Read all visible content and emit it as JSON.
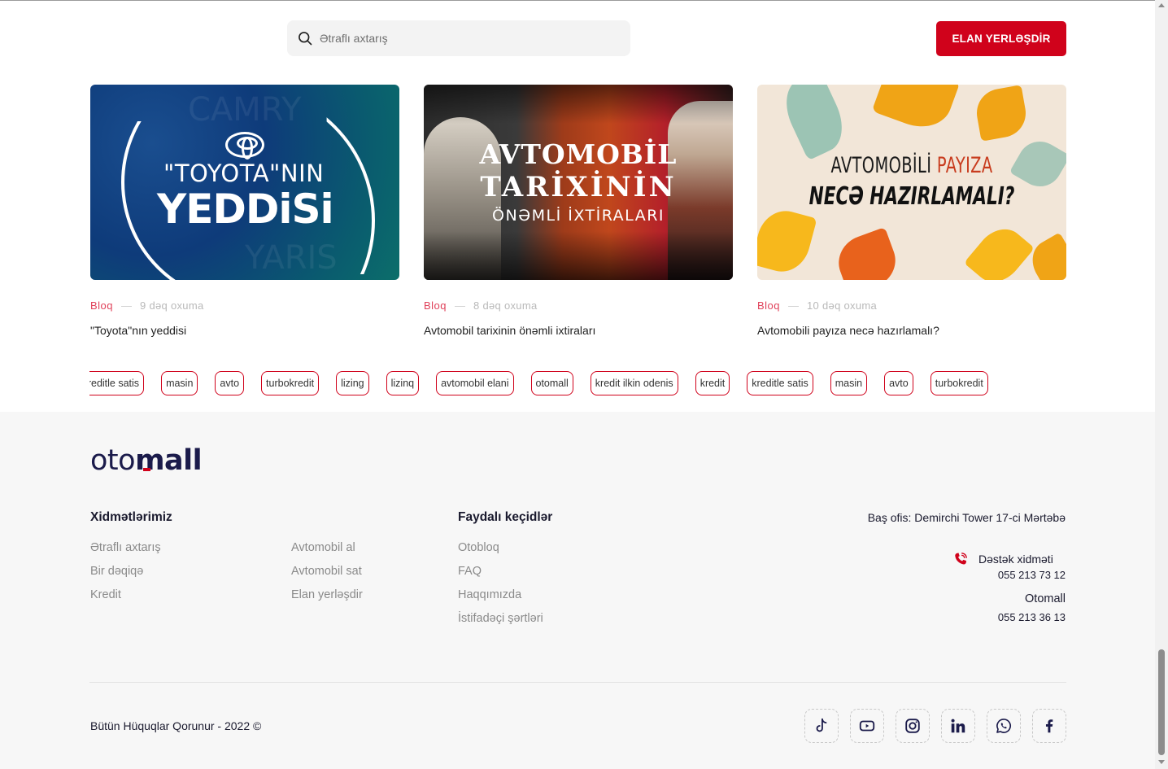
{
  "header": {
    "search_placeholder": "Ətraflı axtarış",
    "cta_label": "ELAN YERLƏŞDİR"
  },
  "cards": [
    {
      "category": "Bloq",
      "read_time": "9 dəq oxuma",
      "title": "\"Toyota\"nın yeddisi",
      "image_line1": "\"TOYOTA\"NIN",
      "image_line2": "YEDDiSi"
    },
    {
      "category": "Bloq",
      "read_time": "8 dəq oxuma",
      "title": "Avtomobil tarixinin önəmli ixtiraları",
      "image_line1": "AVTOMOBİL",
      "image_line2": "TARİXİNİN",
      "image_line3": "ÖNƏMLİ İXTİRALARI"
    },
    {
      "category": "Bloq",
      "read_time": "10 dəq oxuma",
      "title": "Avtomobili payıza necə hazırlamalı?",
      "image_line1a": "AVTOMOBİLİ ",
      "image_line1b": "PAYIZA",
      "image_line2": "NECƏ HAZIRLAMALI?"
    }
  ],
  "tags": [
    "kredit",
    "kreditle satis",
    "masin",
    "avto",
    "turbokredit",
    "lizing",
    "lizinq",
    "avtomobil elani",
    "otomall",
    "kredit ilkin odenis",
    "kredit",
    "kreditle satis",
    "masin",
    "avto",
    "turbokredit"
  ],
  "footer": {
    "brand_light": "oto",
    "brand_bold": "mall",
    "services_heading": "Xidmətlərimiz",
    "services_col1": [
      "Ətraflı axtarış",
      "Bir dəqiqə",
      "Kredit"
    ],
    "services_col2": [
      "Avtomobil al",
      "Avtomobil sat",
      "Elan yerləşdir"
    ],
    "links_heading": "Faydalı keçidlər",
    "links": [
      "Otobloq",
      "FAQ",
      "Haqqımızda",
      "İstifadəçi şərtləri"
    ],
    "office": "Baş ofis: Demirchi Tower 17-ci Mərtəbə",
    "support_label": "Dəstək xidməti",
    "support_phone": "055 213 73 12",
    "otomall_label": "Otomall",
    "otomall_phone": "055 213 36 13",
    "copyright": "Bütün Hüquqlar Qorunur - 2022 ©",
    "social": [
      "tiktok-icon",
      "youtube-icon",
      "instagram-icon",
      "linkedin-icon",
      "whatsapp-icon",
      "facebook-icon"
    ]
  },
  "colors": {
    "accent": "#d0021b",
    "category": "#e0415a",
    "navy": "#1b1b4b"
  }
}
